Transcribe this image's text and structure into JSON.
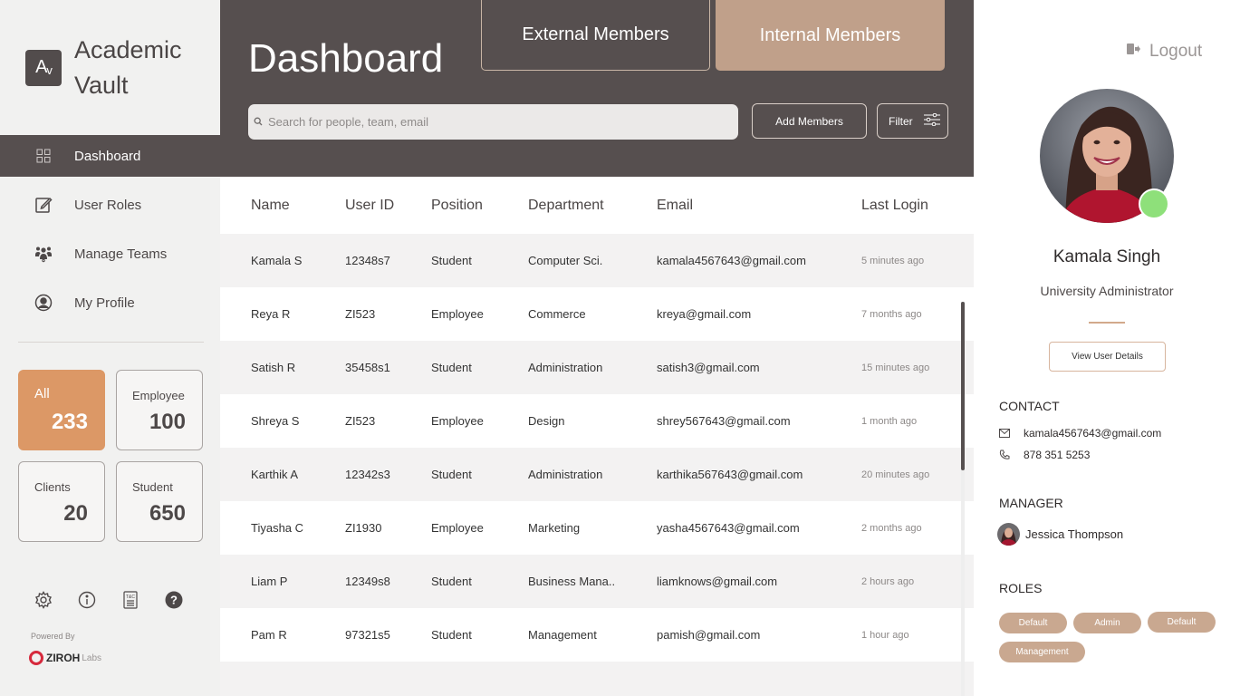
{
  "brand": {
    "logo_letter": "A",
    "logo_sub": "v",
    "name": "Academic Vault"
  },
  "nav": [
    {
      "label": "Dashboard",
      "icon": "grid-icon",
      "active": true
    },
    {
      "label": "User Roles",
      "icon": "edit-icon"
    },
    {
      "label": "Manage Teams",
      "icon": "team-icon"
    },
    {
      "label": "My Profile",
      "icon": "user-circle-icon"
    }
  ],
  "stats": [
    {
      "label": "All",
      "value": "233",
      "active": true
    },
    {
      "label": "Employee",
      "value": "100"
    },
    {
      "label": "Clients",
      "value": "20"
    },
    {
      "label": "Student",
      "value": "650"
    }
  ],
  "footer": {
    "icons": [
      "settings-icon",
      "info-icon",
      "terms-icon",
      "help-icon"
    ],
    "terms_glyph": "T&C",
    "help_glyph": "?",
    "powered_by": "Powered By",
    "company": "ZIROH",
    "company_suffix": "Labs"
  },
  "header": {
    "title": "Dashboard",
    "tabs": {
      "external": "External Members",
      "internal": "Internal Members",
      "active": "internal"
    },
    "search_placeholder": "Search for people, team, email",
    "add_button": "Add Members",
    "filter_button": "Filter"
  },
  "table": {
    "columns": [
      "Name",
      "User ID",
      "Position",
      "Department",
      "Email",
      "Last Login"
    ],
    "rows": [
      [
        "Kamala S",
        "12348s7",
        "Student",
        "Computer Sci.",
        "kamala4567643@gmail.com",
        "5 minutes ago"
      ],
      [
        "Reya R",
        "ZI523",
        "Employee",
        "Commerce",
        "kreya@gmail.com",
        "7 months ago"
      ],
      [
        "Satish R",
        "35458s1",
        "Student",
        "Administration",
        "satish3@gmail.com",
        "15 minutes ago"
      ],
      [
        "Shreya S",
        "ZI523",
        "Employee",
        "Design",
        "shrey567643@gmail.com",
        "1 month ago"
      ],
      [
        "Karthik A",
        "12342s3",
        "Student",
        "Administration",
        "karthika567643@gmail.com",
        "20 minutes ago"
      ],
      [
        "Tiyasha C",
        "ZI1930",
        "Employee",
        "Marketing",
        "yasha4567643@gmail.com",
        "2 months ago"
      ],
      [
        "Liam P",
        "12349s8",
        "Student",
        "Business Mana..",
        "liamknows@gmail.com",
        "2 hours ago"
      ],
      [
        "Pam R",
        "97321s5",
        "Student",
        "Management",
        "pamish@gmail.com",
        "1 hour ago"
      ]
    ]
  },
  "profile": {
    "logout": "Logout",
    "name": "Kamala Singh",
    "role": "University Administrator",
    "online": true,
    "view_details": "View User Details",
    "contact_title": "CONTACT",
    "email": "kamala4567643@gmail.com",
    "phone": "878 351 5253",
    "manager_title": "MANAGER",
    "manager_name": "Jessica Thompson",
    "roles_title": "ROLES",
    "roles": [
      "Default",
      "Admin",
      "Default",
      "Management"
    ]
  },
  "colors": {
    "header_bg": "#564f4f",
    "accent_orange": "#dc9866",
    "chip_tan": "#c9a890",
    "online_green": "#8ee07a"
  }
}
